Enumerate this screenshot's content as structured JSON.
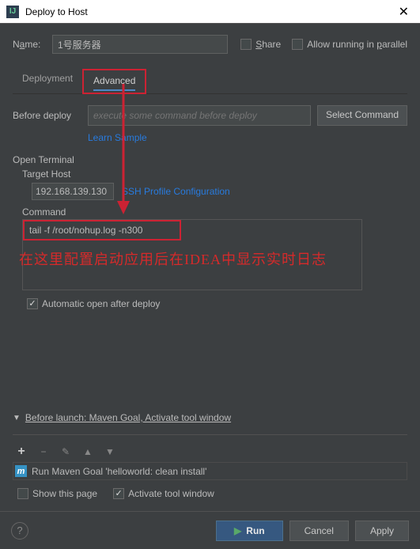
{
  "window": {
    "title": "Deploy to Host"
  },
  "name": {
    "label_pre": "N",
    "label_u": "a",
    "label_post": "me:",
    "value": "1号服务器"
  },
  "options": {
    "share_pre": "",
    "share_u": "S",
    "share_post": "hare",
    "parallel_pre": "Allow running in ",
    "parallel_u": "p",
    "parallel_post": "arallel"
  },
  "tabs": {
    "deployment": "Deployment",
    "advanced": "Advanced"
  },
  "before_deploy": {
    "label": "Before deploy",
    "placeholder": "execute some command before deploy",
    "select_btn": "Select Command",
    "learn": "Learn Sample"
  },
  "terminal": {
    "open": "Open Terminal",
    "target": "Target Host",
    "ip": "192.168.139.130",
    "ssh": "SSH Profile Configuration",
    "command_lbl": "Command",
    "command_val": "tail -f /root/nohup.log -n300",
    "auto": "Automatic open after deploy"
  },
  "annotation": "在这里配置启动应用后在IDEA中显示实时日志",
  "before_launch": {
    "label": "Before launch: Maven Goal, Activate tool window",
    "maven": "Run Maven Goal 'helloworld: clean install'",
    "show": "Show this page",
    "activate": "Activate tool window"
  },
  "footer": {
    "run": "Run",
    "cancel": "Cancel",
    "apply": "Apply"
  }
}
